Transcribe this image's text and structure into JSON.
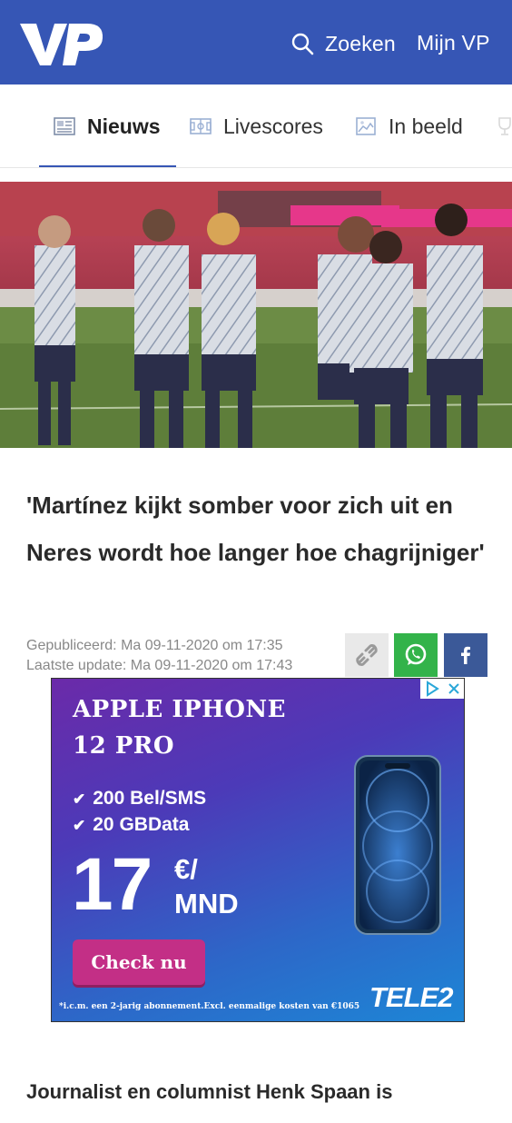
{
  "header": {
    "logo_text": "VP",
    "search_label": "Zoeken",
    "account_label": "Mijn VP",
    "brand_color": "#3656b5"
  },
  "tabs": [
    {
      "label": "Nieuws",
      "icon": "newspaper-icon",
      "active": true
    },
    {
      "label": "Livescores",
      "icon": "pitch-icon",
      "active": false
    },
    {
      "label": "In beeld",
      "icon": "picture-icon",
      "active": false
    }
  ],
  "article": {
    "title": "'Martínez kijkt somber voor zich uit en Neres wordt hoe langer hoe chagrijniger'",
    "published": "Gepubliceerd: Ma 09-11-2020 om 17:35",
    "updated": "Laatste update: Ma 09-11-2020 om 17:43",
    "lead": "Journalist en columnist Henk Spaan is"
  },
  "share": {
    "copy_icon": "link-icon",
    "whatsapp_icon": "whatsapp-icon",
    "facebook_icon": "facebook-icon"
  },
  "ad": {
    "headline": "APPLE IPHONE 12 PRO",
    "feature1": "200 Bel/SMS",
    "feature2": "20 GBData",
    "price_amount": "17",
    "price_unit1": "€/",
    "price_unit2": "MND",
    "cta_label": "Check nu",
    "brand": "TELE2",
    "disclaimer": "*i.c.m. een 2-jarig abonnement.Excl. eenmalige kosten van €1065"
  }
}
